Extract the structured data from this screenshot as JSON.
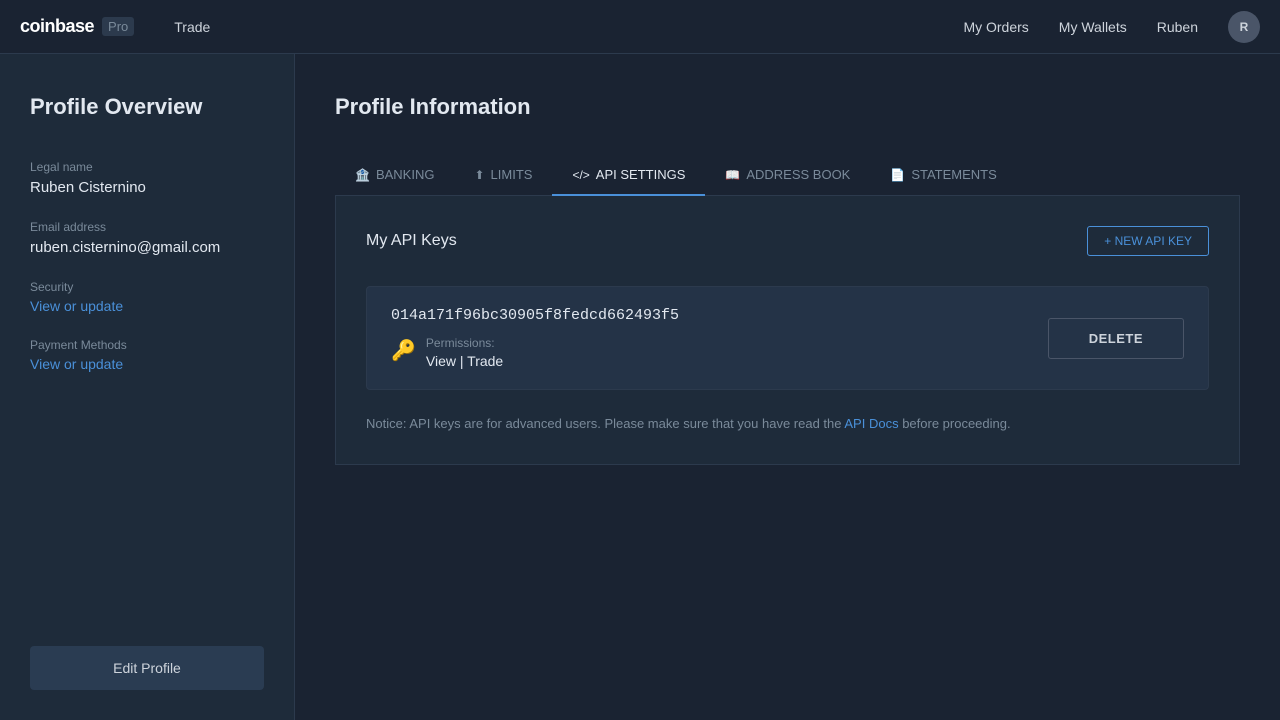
{
  "navbar": {
    "brand": "coinbase",
    "pro_label": "Pro",
    "nav_trade": "Trade",
    "nav_my_orders": "My Orders",
    "nav_my_wallets": "My Wallets",
    "user_name": "Ruben",
    "user_initials": "R"
  },
  "sidebar": {
    "title": "Profile Overview",
    "legal_name_label": "Legal name",
    "legal_name_value": "Ruben Cisternino",
    "email_label": "Email address",
    "email_value": "ruben.cisternino@gmail.com",
    "security_label": "Security",
    "security_link": "View or update",
    "payment_label": "Payment Methods",
    "payment_link": "View or update",
    "edit_profile_btn": "Edit Profile"
  },
  "content": {
    "title": "Profile Information",
    "tabs": [
      {
        "id": "banking",
        "icon": "🏦",
        "label": "BANKING"
      },
      {
        "id": "limits",
        "icon": "⬆",
        "label": "LIMITS"
      },
      {
        "id": "api-settings",
        "icon": "</>",
        "label": "API SETTINGS",
        "active": true
      },
      {
        "id": "address-book",
        "icon": "📖",
        "label": "ADDRESS BOOK"
      },
      {
        "id": "statements",
        "icon": "📄",
        "label": "STATEMENTS"
      }
    ],
    "panel": {
      "title": "My API Keys",
      "new_key_btn": "+ NEW API KEY",
      "api_keys": [
        {
          "hash": "014a171f96bc30905f8fedcd662493f5",
          "permissions_label": "Permissions:",
          "permissions_value": "View | Trade"
        }
      ],
      "delete_btn": "DELETE",
      "notice_text": "Notice: API keys are for advanced users. Please make sure that you have read the ",
      "notice_link": "API Docs",
      "notice_suffix": " before proceeding."
    }
  }
}
